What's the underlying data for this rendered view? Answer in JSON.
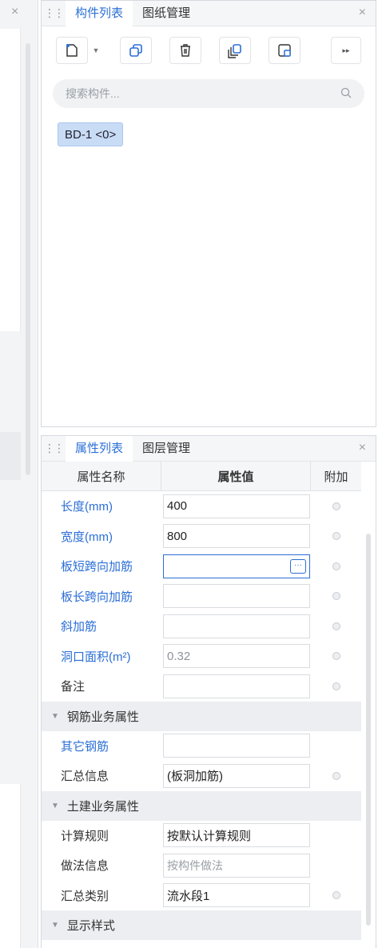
{
  "left_strip": {
    "close_glyph": "×"
  },
  "top_panel": {
    "tabs": [
      {
        "label": "构件列表",
        "active": true
      },
      {
        "label": "图纸管理",
        "active": false
      }
    ],
    "close_glyph": "×",
    "toolbar": {
      "buttons": [
        "new-component-icon",
        "copy-icon",
        "delete-icon",
        "layer-copy-icon",
        "export-icon"
      ],
      "more_glyph": "▸▸"
    },
    "search": {
      "placeholder": "搜索构件..."
    },
    "components": [
      {
        "label": "BD-1 <0>"
      }
    ]
  },
  "bottom_panel": {
    "tabs": [
      {
        "label": "属性列表",
        "active": true
      },
      {
        "label": "图层管理",
        "active": false
      }
    ],
    "close_glyph": "×",
    "columns": {
      "name": "属性名称",
      "value": "属性值",
      "extra": "附加"
    },
    "rows": [
      {
        "name": "长度(mm)",
        "value": "400",
        "style": "blue"
      },
      {
        "name": "宽度(mm)",
        "value": "800",
        "style": "blue"
      },
      {
        "name": "板短跨向加筋",
        "value": "",
        "style": "blue",
        "focused": true
      },
      {
        "name": "板长跨向加筋",
        "value": "",
        "style": "blue"
      },
      {
        "name": "斜加筋",
        "value": "",
        "style": "blue"
      },
      {
        "name": "洞口面积(m²)",
        "value": "0.32",
        "style": "blue",
        "muted": true
      },
      {
        "name": "备注",
        "value": "",
        "style": "dark"
      }
    ],
    "group_rebar": {
      "title": "钢筋业务属性",
      "rows": [
        {
          "name": "其它钢筋",
          "value": "",
          "style": "blue",
          "dot": false
        },
        {
          "name": "汇总信息",
          "value": "(板洞加筋)",
          "style": "dark",
          "dot": true
        }
      ]
    },
    "group_civil": {
      "title": "土建业务属性",
      "rows": [
        {
          "name": "计算规则",
          "value": "按默认计算规则",
          "style": "dark",
          "dot": false
        },
        {
          "name": "做法信息",
          "value": "按构件做法",
          "style": "dark",
          "dot": false,
          "placeholder": true
        },
        {
          "name": "汇总类别",
          "value": "流水段1",
          "style": "dark",
          "dot": true
        }
      ]
    },
    "group_display": {
      "title": "显示样式"
    }
  },
  "colors": {
    "accent": "#2b6fd6",
    "chip": "#c9dcf5"
  }
}
